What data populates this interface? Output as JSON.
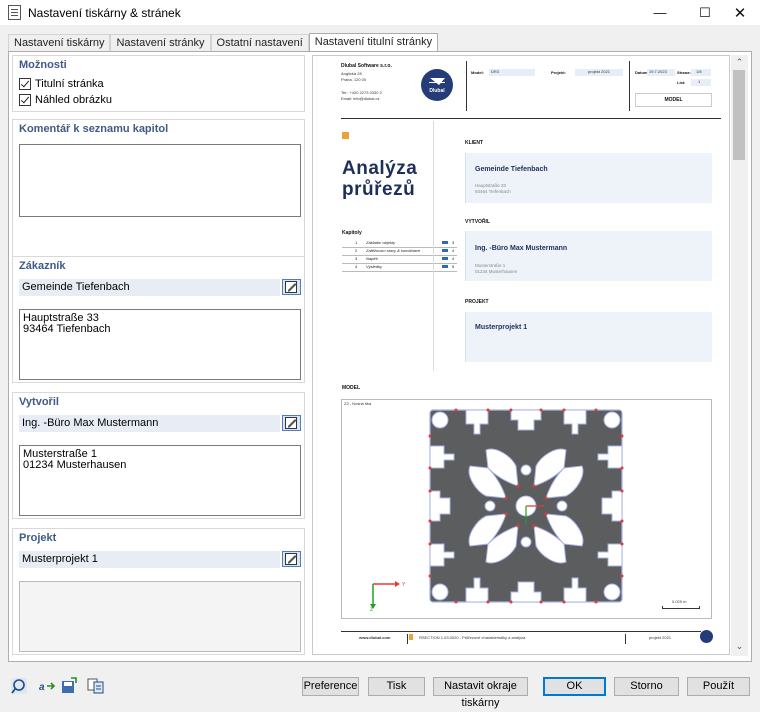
{
  "window": {
    "title": "Nastavení tiskárny & stránek"
  },
  "tabs": [
    {
      "label": "Nastavení tiskárny"
    },
    {
      "label": "Nastavení stránky"
    },
    {
      "label": "Ostatní nastavení"
    },
    {
      "label": "Nastavení titulní stránky"
    }
  ],
  "options": {
    "title": "Možnosti",
    "title_page_label": "Titulní stránka",
    "title_page_checked": true,
    "image_preview_label": "Náhled obrázku",
    "image_preview_checked": true
  },
  "comment": {
    "title": "Komentář k seznamu kapitol",
    "value": ""
  },
  "customer": {
    "title": "Zákazník",
    "name": "Gemeinde Tiefenbach",
    "address": "Hauptstraße 33\n93464 Tiefenbach"
  },
  "creator": {
    "title": "Vytvořil",
    "name": "Ing. -Büro Max Mustermann",
    "address": "Musterstraße 1\n01234 Musterhausen"
  },
  "project": {
    "title": "Projekt",
    "name": "Musterprojekt 1",
    "address": ""
  },
  "preview": {
    "company": "Dlubal Software s.r.o.",
    "company_addr1": "Anglická 28",
    "company_addr2": "Praha, 120 00",
    "company_tel": "Tel.: +420 2273 0330 2",
    "company_email": "Email: info@dlubal.cz",
    "logo_text": "Dlubal",
    "model_label": "Model:",
    "model_value": "DR3",
    "project_label": "Projekt:",
    "project_value": "projekt 2021",
    "date_label": "Datum:",
    "date_value": "19.7.2023",
    "page_label": "Strana:",
    "page_value": "1/8",
    "sheet_label": "List:",
    "sheet_value": "1",
    "model_box": "MODEL",
    "heading_line1": "Analýza",
    "heading_line2": "průřezů",
    "client_heading": "KLIENT",
    "client_name": "Gemeinde Tiefenbach",
    "client_addr1": "Hauptstraße 33",
    "client_addr2": "93464 Tiefenbach",
    "creator_heading": "VYTVOŘIL",
    "creator_name": "Ing. -Büro Max Mustermann",
    "creator_addr1": "Musterstraße 1",
    "creator_addr2": "01234 Musterhausen",
    "project_heading": "PROJEKT",
    "project_name": "Musterprojekt 1",
    "chapters_title": "Kapitoly",
    "chapters": [
      {
        "no": "1",
        "name": "Základní objekty",
        "page": "3"
      },
      {
        "no": "2",
        "name": "Zatěžovací stavy & kombinace",
        "page": "4"
      },
      {
        "no": "3",
        "name": "Napětí",
        "page": "4"
      },
      {
        "no": "4",
        "name": "Výsledky",
        "page": "5"
      }
    ],
    "model_section": "MODEL",
    "model_caption": "Z3 - Nosná tlka",
    "scale_label": "0.029 m",
    "axis_y": "Y",
    "axis_z": "Z",
    "footer_web": "www.dlubal.com",
    "footer_product": "RSECTION 1.03.0020 - Průřezové charakteristiky a analýza",
    "footer_project": "projekt 2021"
  },
  "buttons": {
    "preferences": "Preference",
    "print": "Tisk",
    "set_margins": "Nastavit okraje tiskárny",
    "ok": "OK",
    "cancel": "Storno",
    "apply": "Použít"
  },
  "colors": {
    "accent": "#3f5a84",
    "preview_blue": "#1e2f5a",
    "logo_blue": "#243c77",
    "orange": "#e8a33a",
    "steel": "#5b5d5e"
  }
}
